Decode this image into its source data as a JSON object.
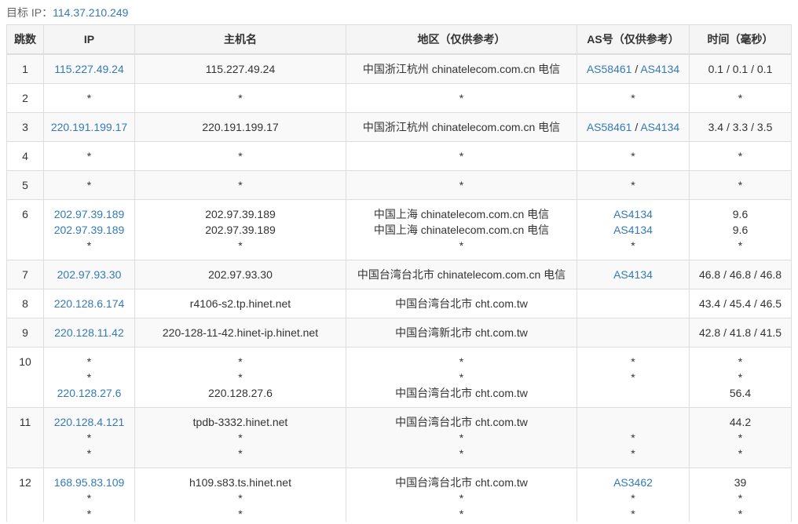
{
  "target": {
    "label": "目标 IP：",
    "ip": "114.37.210.249"
  },
  "colors": {
    "link": "#337ab7",
    "text": "#333333",
    "border": "#dddddd",
    "stripe": "#f9f9f9"
  },
  "columns": [
    "跳数",
    "IP",
    "主机名",
    "地区（仅供参考）",
    "AS号（仅供参考）",
    "时间（毫秒）"
  ],
  "as_separator": " / ",
  "hops": [
    {
      "hop": "1",
      "lines": [
        {
          "ip": "115.227.49.24",
          "host": "115.227.49.24",
          "region": "中国浙江杭州 chinatelecom.com.cn 电信",
          "as": [
            "AS58461",
            "AS4134"
          ],
          "time": "0.1 / 0.1 / 0.1"
        }
      ]
    },
    {
      "hop": "2",
      "lines": [
        {
          "ip": "*",
          "host": "*",
          "region": "*",
          "as": [
            "*"
          ],
          "time": "*"
        }
      ]
    },
    {
      "hop": "3",
      "lines": [
        {
          "ip": "220.191.199.17",
          "host": "220.191.199.17",
          "region": "中国浙江杭州 chinatelecom.com.cn 电信",
          "as": [
            "AS58461",
            "AS4134"
          ],
          "time": "3.4 / 3.3 / 3.5"
        }
      ]
    },
    {
      "hop": "4",
      "lines": [
        {
          "ip": "*",
          "host": "*",
          "region": "*",
          "as": [
            "*"
          ],
          "time": "*"
        }
      ]
    },
    {
      "hop": "5",
      "lines": [
        {
          "ip": "*",
          "host": "*",
          "region": "*",
          "as": [
            "*"
          ],
          "time": "*"
        }
      ]
    },
    {
      "hop": "6",
      "lines": [
        {
          "ip": "202.97.39.189",
          "host": "202.97.39.189",
          "region": "中国上海 chinatelecom.com.cn 电信",
          "as": [
            "AS4134"
          ],
          "time": "9.6"
        },
        {
          "ip": "202.97.39.189",
          "host": "202.97.39.189",
          "region": "中国上海 chinatelecom.com.cn 电信",
          "as": [
            "AS4134"
          ],
          "time": "9.6"
        },
        {
          "ip": "*",
          "host": "*",
          "region": "*",
          "as": [
            "*"
          ],
          "time": "*"
        }
      ]
    },
    {
      "hop": "7",
      "lines": [
        {
          "ip": "202.97.93.30",
          "host": "202.97.93.30",
          "region": "中国台湾台北市 chinatelecom.com.cn 电信",
          "as": [
            "AS4134"
          ],
          "time": "46.8 / 46.8 / 46.8"
        }
      ]
    },
    {
      "hop": "8",
      "lines": [
        {
          "ip": "220.128.6.174",
          "host": "r4106-s2.tp.hinet.net",
          "region": "中国台湾台北市 cht.com.tw",
          "as": [],
          "time": "43.4 / 45.4 / 46.5"
        }
      ]
    },
    {
      "hop": "9",
      "lines": [
        {
          "ip": "220.128.11.42",
          "host": "220-128-11-42.hinet-ip.hinet.net",
          "region": "中国台湾新北市 cht.com.tw",
          "as": [],
          "time": "42.8 / 41.8 / 41.5"
        }
      ]
    },
    {
      "hop": "10",
      "lines": [
        {
          "ip": "*",
          "host": "*",
          "region": "*",
          "as": [
            "*"
          ],
          "time": "*"
        },
        {
          "ip": "*",
          "host": "*",
          "region": "*",
          "as": [
            "*"
          ],
          "time": "*"
        },
        {
          "ip": "220.128.27.6",
          "host": "220.128.27.6",
          "region": "中国台湾台北市 cht.com.tw",
          "as": [],
          "time": "56.4"
        }
      ]
    },
    {
      "hop": "11",
      "lines": [
        {
          "ip": "220.128.4.121",
          "host": "tpdb-3332.hinet.net",
          "region": "中国台湾台北市 cht.com.tw",
          "as": [],
          "time": "44.2"
        },
        {
          "ip": "*",
          "host": "*",
          "region": "*",
          "as": [
            "*"
          ],
          "time": "*"
        },
        {
          "ip": "*",
          "host": "*",
          "region": "*",
          "as": [
            "*"
          ],
          "time": "*"
        }
      ]
    },
    {
      "hop": "12",
      "lines": [
        {
          "ip": "168.95.83.109",
          "host": "h109.s83.ts.hinet.net",
          "region": "中国台湾台北市 cht.com.tw",
          "as": [
            "AS3462"
          ],
          "time": "39"
        },
        {
          "ip": "*",
          "host": "*",
          "region": "*",
          "as": [
            "*"
          ],
          "time": "*"
        },
        {
          "ip": "*",
          "host": "*",
          "region": "*",
          "as": [
            "*"
          ],
          "time": "*"
        }
      ]
    }
  ]
}
